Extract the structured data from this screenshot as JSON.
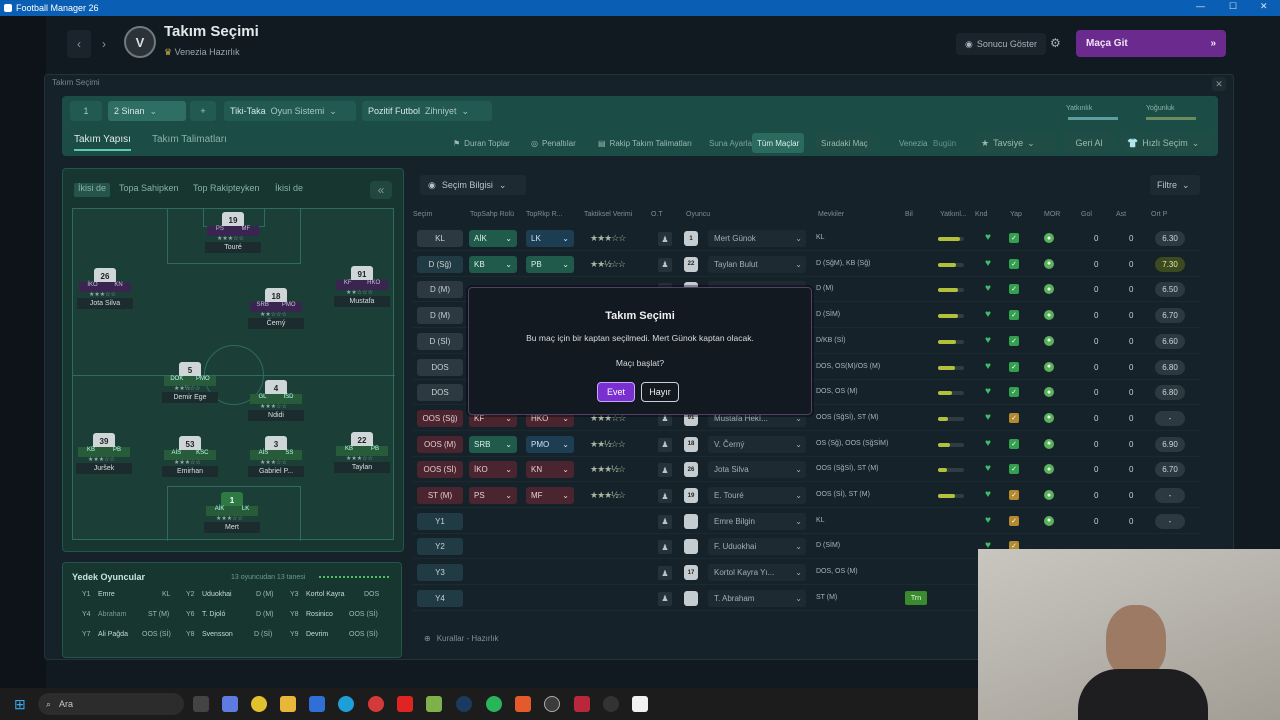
{
  "window": {
    "title": "Football Manager 26"
  },
  "header": {
    "team_name": "Takım Seçimi",
    "subtitle": "Venezia  Hazırlık",
    "crest": "V",
    "result_button": "Sonucu Göster",
    "match_button": "Maça Git"
  },
  "panel": {
    "title": "Takım Seçimi"
  },
  "tactic_bar": {
    "slot1": "1",
    "slot2": "2 Sinan",
    "style_name": "Tiki-Taka",
    "style_label": "Oyun Sistemi",
    "mentality_name": "Pozitif Futbol",
    "mentality_label": "Zihniyet",
    "right1": "Yatkınlık",
    "right2": "Yoğunluk"
  },
  "tabs": {
    "structure": "Takım Yapısı",
    "instructions": "Takım Talimatları"
  },
  "controls": {
    "set_pieces": "Duran Toplar",
    "penalties": "Penaltılar",
    "opp_instructions": "Rakip Takım Talimatları",
    "suna_ayarla": "Suna Ayarla",
    "all_matches": "Tüm Maçlar",
    "next_match": "Sıradaki Maç",
    "venezia": "Venezia",
    "bugun": "Bugün",
    "recommend": "Tavsiye",
    "undo": "Geri Al",
    "quick_select": "Hızlı Seçim"
  },
  "pitch_tabs": [
    "İkisi de",
    "Topa Sahipken",
    "Top Rakipteyken",
    "İkisi de"
  ],
  "pitch_players": [
    {
      "num": "19",
      "r1": "PS",
      "r2": "MF",
      "name": "Touré"
    },
    {
      "num": "26",
      "r1": "İKO",
      "r2": "KN",
      "name": "Jota Silva"
    },
    {
      "num": "91",
      "r1": "KF",
      "r2": "HKO",
      "name": "Mustafa"
    },
    {
      "num": "18",
      "r1": "SRB",
      "r2": "PMO",
      "name": "Černý"
    },
    {
      "num": "5",
      "r1": "DOK",
      "r2": "PMO",
      "name": "Demir Ege"
    },
    {
      "num": "4",
      "r1": "GL",
      "r2": "İSD",
      "name": "Ndidi"
    },
    {
      "num": "39",
      "r1": "KB",
      "r2": "PB",
      "name": "Juršek"
    },
    {
      "num": "53",
      "r1": "AİS",
      "r2": "KSC",
      "name": "Emirhan"
    },
    {
      "num": "3",
      "r1": "AİS",
      "r2": "SS",
      "name": "Gabriel P..."
    },
    {
      "num": "22",
      "r1": "KB",
      "r2": "PB",
      "name": "Taylan"
    },
    {
      "num": "1",
      "r1": "AİK",
      "r2": "LK",
      "name": "Mert"
    }
  ],
  "subs": {
    "title": "Yedek Oyuncular",
    "count": "13 oyuncudan 13 tanesi",
    "rows": [
      [
        {
          "id": "Y1",
          "name": "Emre",
          "pos": "KL"
        },
        {
          "id": "Y2",
          "name": "Uduokhai",
          "pos": "D (M)"
        },
        {
          "id": "Y3",
          "name": "Kortol Kayra",
          "pos": "DOS"
        }
      ],
      [
        {
          "id": "Y4",
          "name": "Abraham",
          "pos": "ST (M)"
        },
        {
          "id": "Y6",
          "name": "T. Djoló",
          "pos": "D (M)"
        },
        {
          "id": "Y8",
          "name": "Rosinico",
          "pos": "OOS (Sİ)"
        }
      ],
      [
        {
          "id": "Y7",
          "name": "Ali Pağda",
          "pos": "OOS (Sİ)"
        },
        {
          "id": "Y8",
          "name": "Svensson",
          "pos": "D (Sİ)"
        },
        {
          "id": "Y9",
          "name": "Devrim",
          "pos": "OOS (Sİ)"
        }
      ]
    ]
  },
  "table": {
    "selection_info": "Seçim Bilgisi",
    "filter": "Filtre",
    "headers": [
      "Seçim",
      "TopSahp Rolü",
      "TopRkp R...",
      "Taktiksel Verimi",
      "O.T",
      "Oyuncu",
      "Mevkiler",
      "Bil",
      "Yatkınl...",
      "Knd",
      "Yap",
      "MOR",
      "Gol",
      "Ast",
      "Ort P"
    ],
    "rows": [
      {
        "sel": "KL",
        "r1": "AİK",
        "r2": "LK",
        "stars": "★★★☆☆",
        "shirt": "1",
        "name": "Mert Günok",
        "pos": "KL",
        "bar": 0.85,
        "gol": "0",
        "ast": "0",
        "rating": "6.30",
        "sel_color": "gray",
        "r1_color": "g",
        "r2_color": "b",
        "chk": "g"
      },
      {
        "sel": "D (Sğ)",
        "r1": "KB",
        "r2": "PB",
        "stars": "★★½☆☆",
        "shirt": "22",
        "name": "Taylan Bulut",
        "pos": "D (SğM), KB (Sğ)",
        "bar": 0.7,
        "gol": "0",
        "ast": "0",
        "rating": "7.30",
        "sel_color": "grn",
        "r1_color": "g",
        "r2_color": "g",
        "chk": "g"
      },
      {
        "sel": "D (M)",
        "r1": "",
        "r2": "",
        "stars": "",
        "shirt": "",
        "name": "",
        "pos": "D (M)",
        "bar": 0.75,
        "gol": "0",
        "ast": "0",
        "rating": "6.50",
        "sel_color": "gray",
        "r1_color": "g",
        "r2_color": "g",
        "chk": "g"
      },
      {
        "sel": "D (M)",
        "r1": "",
        "r2": "",
        "stars": "",
        "shirt": "",
        "name": "",
        "pos": "D (SİM)",
        "bar": 0.75,
        "gol": "0",
        "ast": "0",
        "rating": "6.70",
        "sel_color": "gray",
        "r1_color": "g",
        "r2_color": "g",
        "chk": "g"
      },
      {
        "sel": "D (Sİ)",
        "r1": "",
        "r2": "",
        "stars": "",
        "shirt": "",
        "name": "",
        "pos": "D/KB (Sİ)",
        "bar": 0.7,
        "gol": "0",
        "ast": "0",
        "rating": "6.60",
        "sel_color": "gray",
        "r1_color": "g",
        "r2_color": "g",
        "chk": "g"
      },
      {
        "sel": "DOS",
        "r1": "",
        "r2": "",
        "stars": "",
        "shirt": "",
        "name": "",
        "pos": "DOS, OS(M)/OS (M)",
        "bar": 0.65,
        "gol": "0",
        "ast": "0",
        "rating": "6.80",
        "sel_color": "gray",
        "r1_color": "g",
        "r2_color": "g",
        "chk": "g"
      },
      {
        "sel": "DOS",
        "r1": "",
        "r2": "",
        "stars": "",
        "shirt": "",
        "name": "",
        "pos": "DOS, OS (M)",
        "bar": 0.55,
        "gol": "0",
        "ast": "0",
        "rating": "6.80",
        "sel_color": "gray",
        "r1_color": "g",
        "r2_color": "g",
        "chk": "g"
      },
      {
        "sel": "OOS (Sğ)",
        "r1": "KF",
        "r2": "HKO",
        "stars": "★★★☆☆",
        "shirt": "91",
        "name": "Mustafa Hekİ...",
        "pos": "OOS (SğSİ), ST (M)",
        "bar": 0.4,
        "gol": "0",
        "ast": "0",
        "rating": "-",
        "sel_color": "red",
        "r1_color": "r",
        "r2_color": "r",
        "chk": "o"
      },
      {
        "sel": "OOS (M)",
        "r1": "SRB",
        "r2": "PMO",
        "stars": "★★½☆☆",
        "shirt": "18",
        "name": "V. Černý",
        "pos": "OS (Sğ), OOS (SğSİM)",
        "bar": 0.45,
        "gol": "0",
        "ast": "0",
        "rating": "6.90",
        "sel_color": "red",
        "r1_color": "g",
        "r2_color": "b",
        "chk": "g"
      },
      {
        "sel": "OOS (Sİ)",
        "r1": "İKO",
        "r2": "KN",
        "stars": "★★★½☆",
        "shirt": "26",
        "name": "Jota Silva",
        "pos": "OOS (SğSİ), ST (M)",
        "bar": 0.35,
        "gol": "0",
        "ast": "0",
        "rating": "6.70",
        "sel_color": "red",
        "r1_color": "r",
        "r2_color": "r",
        "chk": "g"
      },
      {
        "sel": "ST (M)",
        "r1": "PS",
        "r2": "MF",
        "stars": "★★★½☆",
        "shirt": "19",
        "name": "E. Touré",
        "pos": "OOS (Sİ), ST (M)",
        "bar": 0.65,
        "gol": "0",
        "ast": "0",
        "rating": "-",
        "sel_color": "red",
        "r1_color": "r",
        "r2_color": "r",
        "chk": "o"
      },
      {
        "sel": "Y1",
        "r1": "",
        "r2": "",
        "stars": "",
        "shirt": "",
        "name": "Emre Bilgin",
        "pos": "KL",
        "bar": 0,
        "gol": "0",
        "ast": "0",
        "rating": "-",
        "sel_color": "grn",
        "r1_color": "",
        "r2_color": "",
        "chk": "o"
      },
      {
        "sel": "Y2",
        "r1": "",
        "r2": "",
        "stars": "",
        "shirt": "",
        "name": "F. Uduokhai",
        "pos": "D (SİM)",
        "bar": 0,
        "gol": "",
        "ast": "",
        "rating": "",
        "sel_color": "grn",
        "r1_color": "",
        "r2_color": "",
        "chk": "o"
      },
      {
        "sel": "Y3",
        "r1": "",
        "r2": "",
        "stars": "",
        "shirt": "17",
        "name": "Kortol Kayra Yı...",
        "pos": "DOS, OS (M)",
        "bar": 0,
        "gol": "",
        "ast": "",
        "rating": "",
        "sel_color": "grn",
        "r1_color": "",
        "r2_color": "",
        "chk": ""
      },
      {
        "sel": "Y4",
        "r1": "",
        "r2": "",
        "stars": "",
        "shirt": "",
        "name": "T. Abraham",
        "pos": "ST (M)",
        "bar": 0,
        "gol": "",
        "ast": "",
        "rating": "",
        "sel_color": "grn",
        "r1_color": "",
        "r2_color": "",
        "chk": ""
      }
    ]
  },
  "dialog": {
    "title": "Takım Seçimi",
    "body": "Bu maç için bir kaptan seçilmedi. Mert Günok kaptan olacak.",
    "question": "Maçı başlat?",
    "yes": "Evet",
    "no": "Hayır"
  },
  "footer": {
    "text": "Kurallar - Hazırlık"
  },
  "taskbar": {
    "search_placeholder": "Ara"
  },
  "colors": {
    "accent": "#7a2fd0",
    "tactic_bar": "#1b4c46",
    "titlebar": "#0a5fb4"
  }
}
